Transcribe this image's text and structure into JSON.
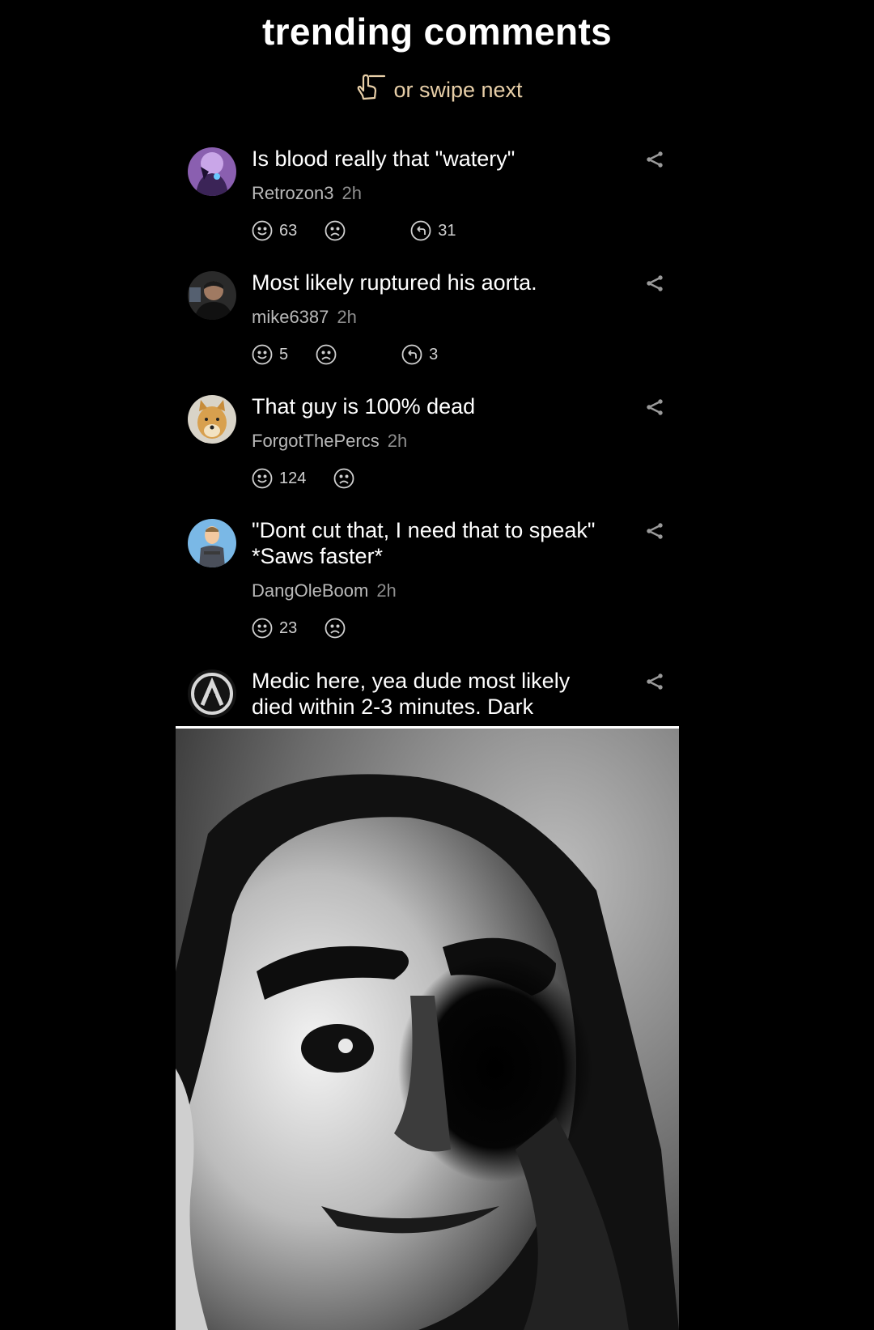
{
  "header": {
    "title": "trending comments",
    "swipe_text": "or swipe next"
  },
  "comments": [
    {
      "text": "Is blood really that \"watery\"",
      "user": "Retrozon3",
      "time": "2h",
      "likes": "63",
      "replies": "31"
    },
    {
      "text": "Most likely ruptured his aorta.",
      "user": "mike6387",
      "time": "2h",
      "likes": "5",
      "replies": "3"
    },
    {
      "text": "That guy is 100% dead",
      "user": "ForgotThePercs",
      "time": "2h",
      "likes": "124"
    },
    {
      "text": "\"Dont cut that, I need that to speak\"\n*Saws faster*",
      "user": "DangOleBoom",
      "time": "2h",
      "likes": "23"
    },
    {
      "text": "Medic here, yea dude most likely\ndied within 2-3 minutes. Dark"
    }
  ],
  "colors": {
    "background": "#000000",
    "accent_swipe": "#e8cfa8",
    "text_primary": "#ffffff",
    "text_secondary": "#b9b9b9"
  }
}
